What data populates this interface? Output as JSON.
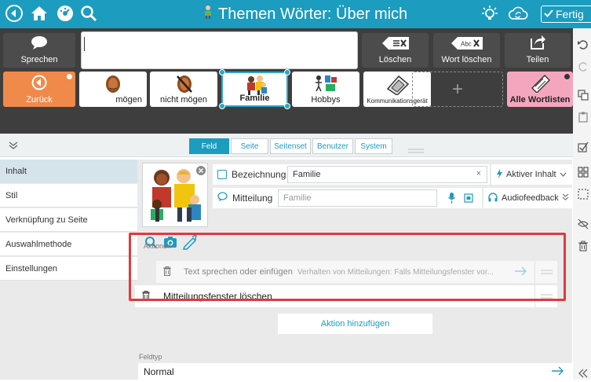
{
  "topbar": {
    "title": "Themen Wörter: Über mich",
    "done_label": "Fertig",
    "icons": [
      "back-icon",
      "home-icon",
      "dashboard-icon",
      "search-icon",
      "person-icon",
      "lightbulb-icon",
      "sync-icon",
      "check-icon"
    ]
  },
  "toolbar": {
    "speak_label": "Sprechen",
    "clear_label": "Löschen",
    "delete_word_label": "Wort löschen",
    "share_label": "Teilen",
    "message_text": ""
  },
  "cells": {
    "back_label": "Zurück",
    "cell1_label": "mögen",
    "cell2_label": "nicht mögen",
    "cell3_label": "Familie",
    "cell4_label": "Hobbys",
    "cell5_label": "Kommunikationsgerät",
    "add_symbol": "+",
    "all_lists_label": "Alle Wortlisten"
  },
  "tabs": {
    "feld": "Feld",
    "seite": "Seite",
    "seitenset": "Seitenset",
    "benutzer": "Benutzer",
    "system": "System",
    "active": "Feld"
  },
  "nav": {
    "items": [
      "Inhalt",
      "Stil",
      "Verknüpfung zu Seite",
      "Auswahlmethode",
      "Einstellungen"
    ],
    "active": "Inhalt"
  },
  "content": {
    "bezeichnung_label": "Bezeichnung",
    "bezeichnung_value": "Familie",
    "aktiver_inhalt": "Aktiver Inhalt",
    "mitteilung_label": "Mitteilung",
    "mitteilung_placeholder": "Familie",
    "audiofeedback": "Audiofeedback",
    "aktionen_label": "Aktionen",
    "action1_title": "Text sprechen oder einfügen",
    "action1_desc": "Verhalten von Mitteilungen: Falls Mitteilungsfenster vor...",
    "action2_title": "Mitteilungsfenster löschen",
    "add_action": "Aktion hinzufügen",
    "feldtyp_label": "Feldtyp",
    "feldtyp_value": "Normal"
  },
  "colors": {
    "accent": "#1c9cbf",
    "toolbar_dark": "#3e3e3e",
    "back_cell": "#f08a4b",
    "all_lists_cell": "#f5a6bf",
    "highlight": "#e03a3a"
  }
}
